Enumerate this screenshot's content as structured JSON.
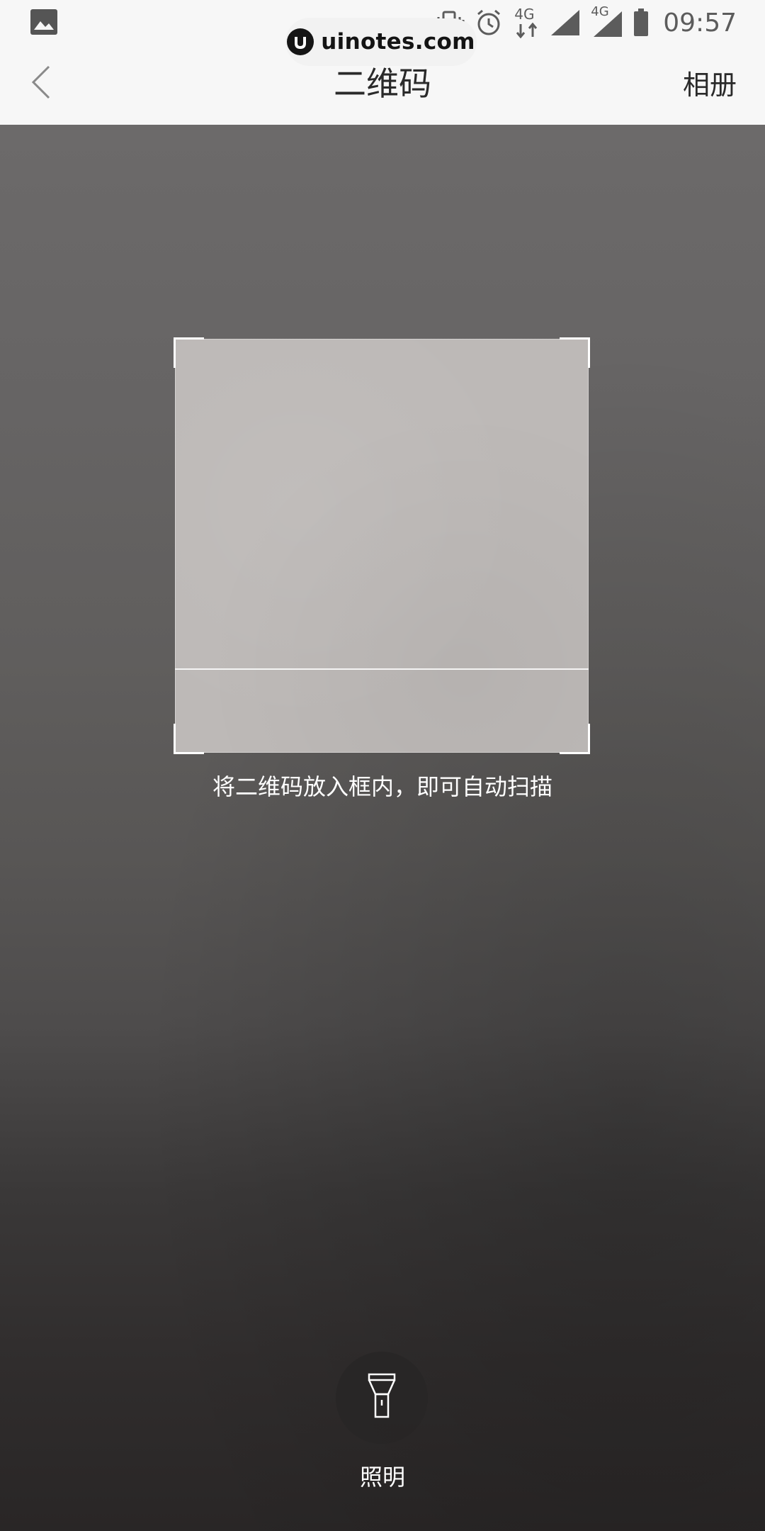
{
  "status_bar": {
    "time": "09:57",
    "left_icon": "image-icon",
    "icons": [
      "vibrate-icon",
      "alarm-icon",
      "4g-data-icon",
      "signal-icon",
      "4g-signal-icon",
      "battery-icon"
    ],
    "network_label_1": "4G",
    "network_label_2": "4G"
  },
  "watermark": {
    "text": "uinotes.com"
  },
  "app_bar": {
    "back_icon": "chevron-left-icon",
    "title": "二维码",
    "album_label": "相册"
  },
  "scanner": {
    "hint": "将二维码放入框内，即可自动扫描"
  },
  "flashlight": {
    "icon": "flashlight-icon",
    "label": "照明"
  },
  "colors": {
    "bar_background": "#f7f7f7",
    "camera_top": "#6c6a6a",
    "camera_bottom": "#292626",
    "frame_fill": "#bdb9b7",
    "frame_corner": "#ffffff"
  }
}
